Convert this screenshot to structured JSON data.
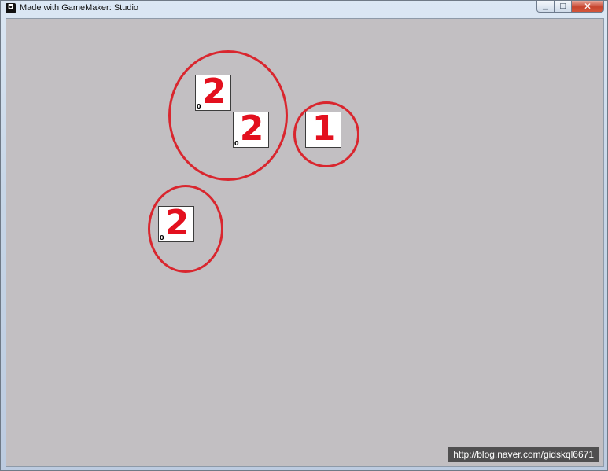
{
  "window": {
    "title": "Made with GameMaker: Studio",
    "icon": "gamemaker-icon",
    "minimize_label": "▁",
    "maximize_label": "□",
    "close_label": "✕"
  },
  "cards": [
    {
      "digit": "2",
      "corner_value": "0"
    },
    {
      "digit": "2",
      "corner_value": "0"
    },
    {
      "digit": "1",
      "corner_value": ""
    },
    {
      "digit": "2",
      "corner_value": "0"
    }
  ],
  "colors": {
    "annotation_ring": "#d9262e",
    "digit": "#e3101e",
    "background": "#c2bfc2"
  },
  "watermark": "http://blog.naver.com/gidskql6671"
}
